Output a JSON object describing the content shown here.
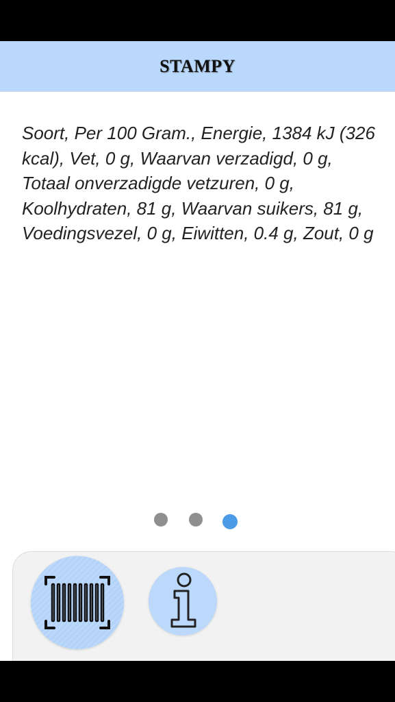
{
  "app": {
    "title": "STAMPY"
  },
  "product": {
    "nutrition_text": "Soort, Per 100 Gram., Energie, 1384 kJ (326 kcal), Vet, 0 g, Waarvan verzadigd, 0 g, Totaal onverzadigde vetzuren, 0 g, Koolhydraten, 81 g, Waarvan suikers, 81 g, Voedingsvezel, 0 g, Eiwitten, 0.4 g, Zout, 0 g"
  },
  "pager": {
    "page_count": 3,
    "active_page": 3
  },
  "toolbar": {
    "buttons": [
      {
        "name": "scan-barcode-button",
        "icon": "barcode-scan-icon"
      },
      {
        "name": "info-button",
        "icon": "info-icon"
      }
    ]
  },
  "colors": {
    "header_bg": "#b9d8fb",
    "button_bg": "#bcd8fb",
    "dot_active": "#4b9be6",
    "dot_inactive": "#8f8f8f",
    "toolbar_bg": "#f2f2f2"
  }
}
